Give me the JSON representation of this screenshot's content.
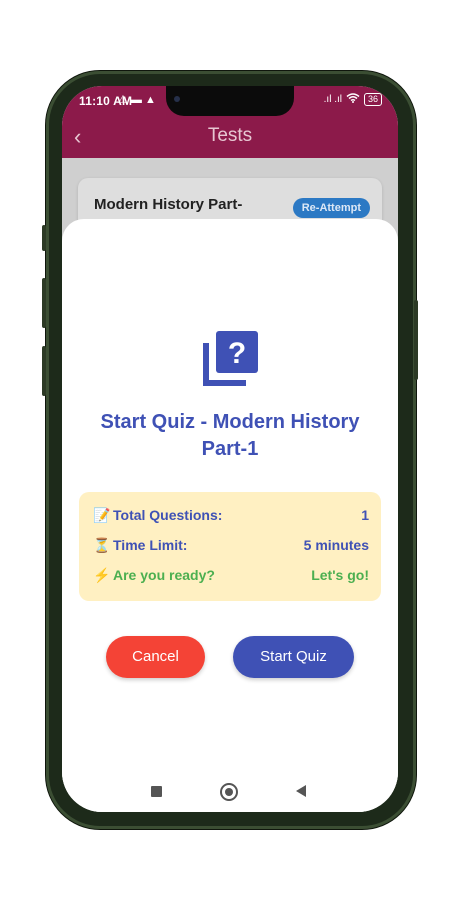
{
  "status_bar": {
    "time": "11:10 AM",
    "notification_icons": "⚠ ▬ ▲",
    "signal": ".ıl .ıl",
    "battery": "36"
  },
  "app_bar": {
    "title": "Tests"
  },
  "test_card": {
    "title": "Modern History Part-1",
    "button_label": "Re-Attempt"
  },
  "dialog": {
    "icon": "quiz-icon",
    "title": "Start Quiz - Modern History Part-1",
    "info": {
      "total_questions_emoji": "📝",
      "total_questions_label": "Total Questions:",
      "total_questions_value": "1",
      "time_limit_emoji": "⏳",
      "time_limit_label": "Time Limit:",
      "time_limit_value": "5 minutes",
      "ready_emoji": "⚡",
      "ready_label": "Are you ready?",
      "ready_value": "Let's go!"
    },
    "cancel_label": "Cancel",
    "start_label": "Start Quiz"
  },
  "colors": {
    "app_bar": "#8c1a4a",
    "primary": "#3f51b5",
    "cancel": "#f44336",
    "info_bg": "#fff0c2",
    "ready_green": "#4caf50",
    "reattempt": "#2c79c4"
  }
}
